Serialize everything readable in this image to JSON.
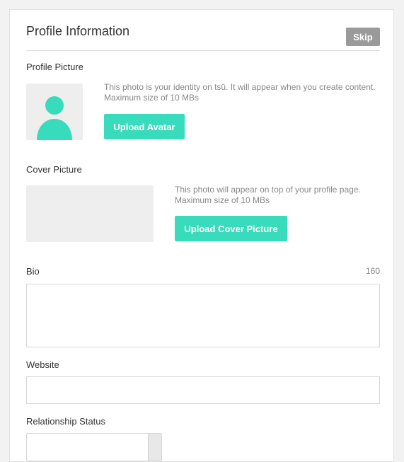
{
  "header": {
    "title": "Profile Information",
    "skip_label": "Skip"
  },
  "profile_picture": {
    "label": "Profile Picture",
    "help_line1": "This photo is your identity on tsū. It will appear when you create content.",
    "help_line2": "Maximum size of 10 MBs",
    "button_label": "Upload Avatar",
    "icon": "user-silhouette-icon"
  },
  "cover_picture": {
    "label": "Cover Picture",
    "help_line1": "This photo will appear on top of your profile page.",
    "help_line2": "Maximum size of 10 MBs",
    "button_label": "Upload Cover Picture"
  },
  "bio": {
    "label": "Bio",
    "char_limit": "160",
    "value": ""
  },
  "website": {
    "label": "Website",
    "value": ""
  },
  "relationship_status": {
    "label": "Relationship Status",
    "selected": ""
  },
  "colors": {
    "accent": "#38dcbc",
    "skip_button": "#9a9a9a",
    "placeholder_bg": "#eeeeee"
  }
}
